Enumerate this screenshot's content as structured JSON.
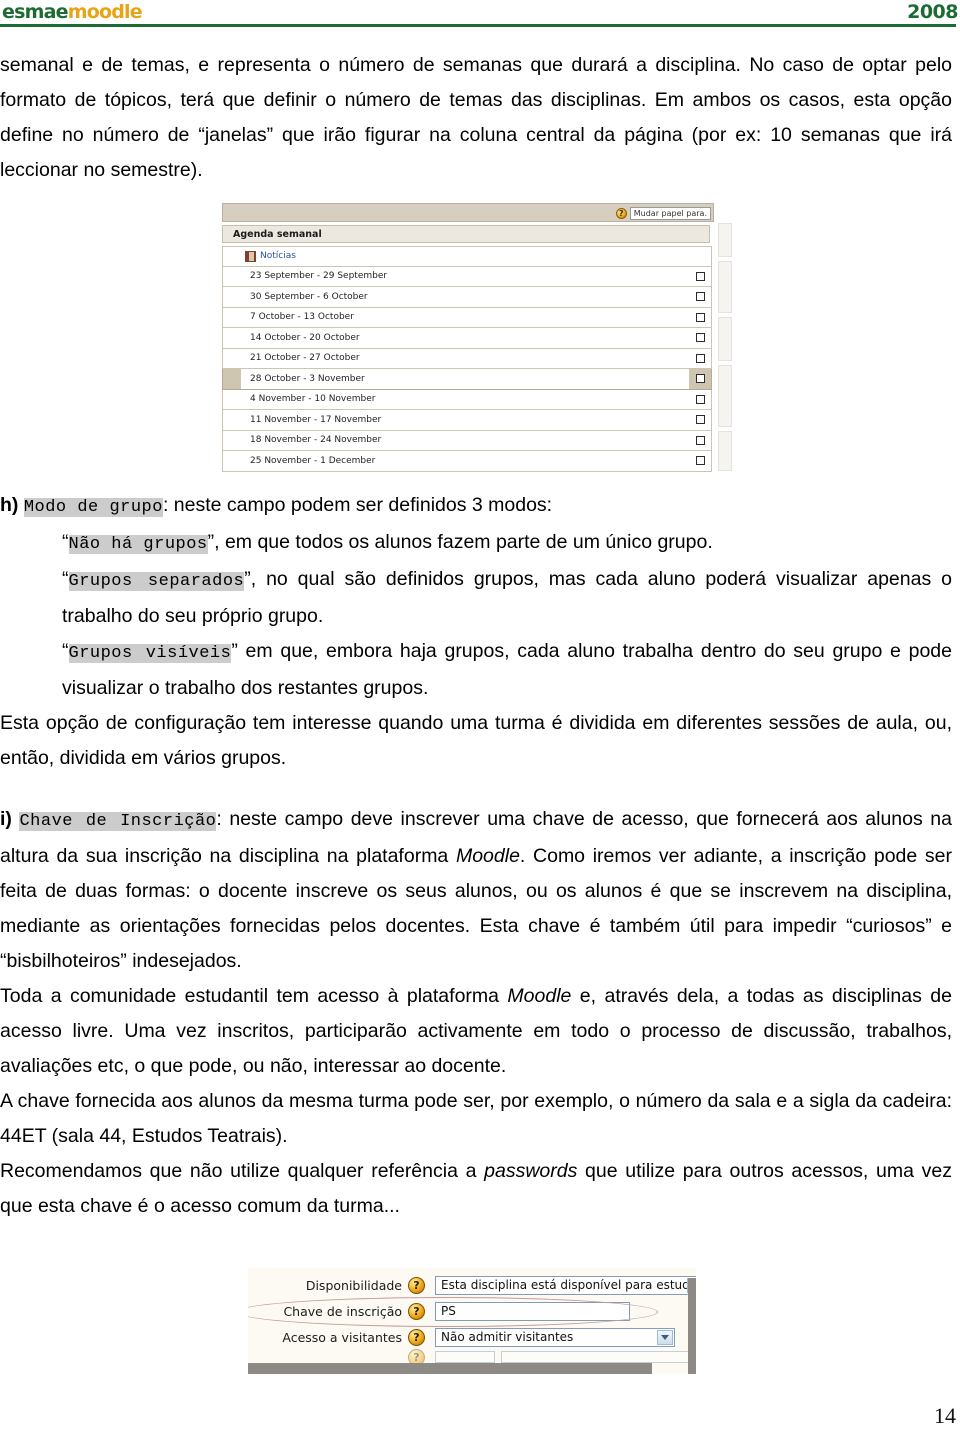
{
  "header": {
    "logo_esmae": "esmae",
    "logo_moodle": "moodle",
    "year": "2008"
  },
  "body_text": {
    "p_intro_1": "semanal e de temas, e representa o número de semanas que durará a disciplina. No caso de optar pelo formato de tópicos, terá que definir o número de temas das disciplinas. Em ambos os casos, esta opção define no número de “janelas” que irão figurar na coluna central da página (por ex: 10 semanas que irá leccionar no semestre).",
    "item_h_marker": "h)",
    "item_h_code": "Modo de grupo",
    "item_h_rest": ": neste campo podem ser definidos 3 modos:",
    "mode1_open_quote": "“",
    "mode1_code": "Não há grupos",
    "mode1_rest": "”, em que todos os alunos fazem parte de um único grupo.",
    "mode2_open_quote": "“",
    "mode2_code": "Grupos separados",
    "mode2_rest": "”, no qual são definidos grupos, mas cada aluno poderá visualizar apenas o trabalho do seu próprio grupo.",
    "mode3_open_quote": "“",
    "mode3_code": "Grupos visíveis",
    "mode3_rest": "” em que, embora haja grupos, cada aluno trabalha dentro do seu grupo e pode visualizar o trabalho dos restantes grupos.",
    "p_groups_note": "Esta opção de configuração tem interesse quando uma turma é dividida em diferentes sessões de aula, ou, então, dividida em vários grupos.",
    "item_i_marker": "i)",
    "item_i_code": "Chave de Inscrição",
    "item_i_part1": ": neste campo deve inscrever uma chave de acesso, que fornecerá aos alunos na altura da sua inscrição na disciplina na plataforma ",
    "item_i_ital1": "Moodle",
    "item_i_part2": ". Como iremos ver adiante, a inscrição pode ser feita de duas formas: o docente inscreve os seus alunos, ou os alunos é que se inscrevem na disciplina, mediante as orientações fornecidas pelos docentes. Esta chave é também útil para impedir “curiosos” e “bisbilhoteiros” indesejados.",
    "p_community_part1": "Toda a  comunidade estudantil tem acesso à plataforma ",
    "p_community_ital": "Moodle",
    "p_community_part2": " e, através dela, a todas as disciplinas de acesso livre. Uma vez inscritos, participarão activamente em todo o processo de discussão, trabalhos, avaliações etc, o que pode, ou não, interessar ao docente.",
    "p_key_example": "A chave fornecida aos alunos da mesma turma pode ser, por exemplo, o número da sala e a sigla da cadeira: 44ET (sala 44, Estudos Teatrais).",
    "p_recommend_part1": "Recomendamos que não utilize qualquer referência a ",
    "p_recommend_ital": "passwords",
    "p_recommend_part2": " que utilize para outros acessos, uma vez que esta chave é o acesso comum da turma..."
  },
  "weekly_screenshot": {
    "role_switch_label": "Mudar papel para.",
    "help_glyph": "?",
    "section_title": "Agenda semanal",
    "news_label": "Notícias",
    "weeks": [
      "23 September - 29 September",
      "30 September - 6 October",
      "7 October - 13 October",
      "14 October - 20 October",
      "21 October - 27 October",
      "28 October - 3 November",
      "4 November - 10 November",
      "11 November - 17 November",
      "18 November - 24 November",
      "25 November - 1 December"
    ],
    "current_week_index": 5
  },
  "form_screenshot": {
    "help_glyph": "?",
    "rows": [
      {
        "label": "Disponibilidade",
        "control": "select",
        "value": "Esta disciplina está disponível para estudantes"
      },
      {
        "label": "Chave de inscrição",
        "control": "input",
        "value": "PS"
      },
      {
        "label": "Acesso a visitantes",
        "control": "select",
        "value": "Não admitir visitantes"
      }
    ]
  },
  "footer": {
    "page_number": "14"
  }
}
